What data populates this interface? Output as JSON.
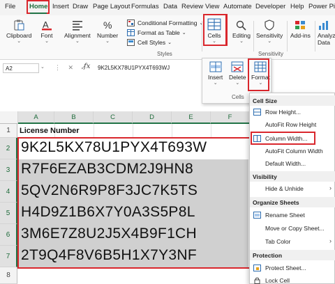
{
  "menu_tabs": [
    "File",
    "Home",
    "Insert",
    "Draw",
    "Page Layout",
    "Formulas",
    "Data",
    "Review",
    "View",
    "Automate",
    "Developer",
    "Help",
    "Power Pivot"
  ],
  "ribbon": {
    "clipboard": "Clipboard",
    "font": "Font",
    "alignment": "Alignment",
    "number": "Number",
    "conditional_formatting": "Conditional Formatting",
    "format_as_table": "Format as Table",
    "cell_styles": "Cell Styles",
    "styles_group": "Styles",
    "cells": "Cells",
    "editing": "Editing",
    "sensitivity": "Sensitivity",
    "sensitivity_group": "Sensitivity",
    "add_ins": "Add-ins",
    "analyze_data": "Analyze Data",
    "analyze_line1": "Analyz",
    "analyze_line2": "Data"
  },
  "formula_bar": {
    "name_box": "A2",
    "fx": "fx",
    "value": "9K2L5KX78U1PYX4T693WJ"
  },
  "cells_popup": {
    "insert": "Insert",
    "delete": "Delete",
    "format": "Format",
    "group_label": "Cells"
  },
  "sheet": {
    "columns": [
      "A",
      "B",
      "C",
      "D",
      "E",
      "F"
    ],
    "rows": [
      "1",
      "2",
      "3",
      "4",
      "5",
      "6",
      "7",
      "8"
    ],
    "header": "License Number",
    "values": [
      "9K2L5KX78U1PYX4T693W",
      "R7F6EZAB3CDM2J9HN8",
      "5QV2N6R9P8F3JC7K5TS",
      "H4D9Z1B6X7Y0A3S5P8L",
      "3M6E7Z8U2J5X4B9F1CH",
      "2T9Q4F8V6B5H1X7Y3NF"
    ]
  },
  "format_menu": {
    "sections": {
      "cell_size": "Cell Size",
      "visibility": "Visibility",
      "organize": "Organize Sheets",
      "protection": "Protection"
    },
    "items": {
      "row_height": "Row Height...",
      "autofit_row": "AutoFit Row Height",
      "column_width": "Column Width...",
      "autofit_col": "AutoFit Column Width",
      "default_width": "Default Width...",
      "hide_unhide": "Hide & Unhide",
      "rename_sheet": "Rename Sheet",
      "move_copy": "Move or Copy Sheet...",
      "tab_color": "Tab Color",
      "protect_sheet": "Protect Sheet...",
      "lock_cell": "Lock Cell"
    }
  },
  "colors": {
    "highlight_red": "#d9262c",
    "excel_green": "#217346"
  }
}
